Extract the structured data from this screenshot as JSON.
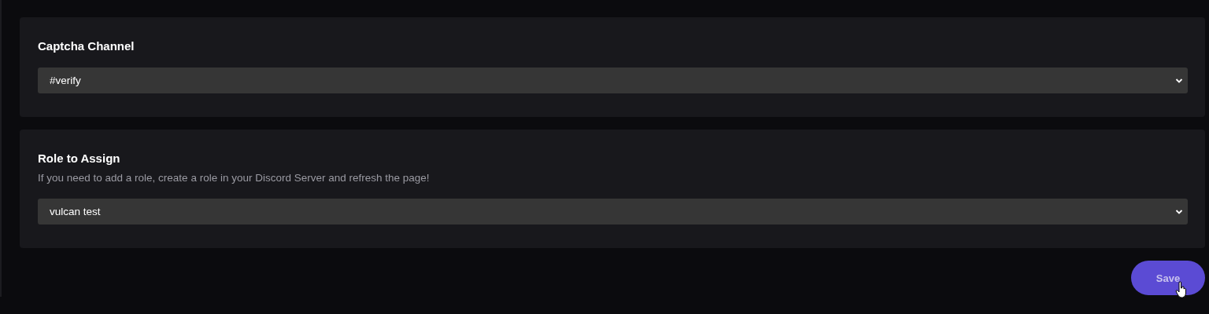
{
  "sections": [
    {
      "title": "Captcha Channel",
      "value": "#verify"
    },
    {
      "title": "Role to Assign",
      "description": "If you need to add a role, create a role in your Discord Server and refresh the page!",
      "value": "vulcan test"
    }
  ],
  "save_button": {
    "label": "Save"
  }
}
